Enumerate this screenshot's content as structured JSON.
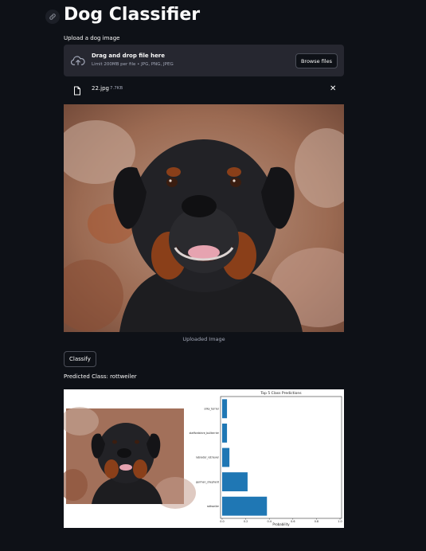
{
  "app": {
    "title": "Dog Classifier"
  },
  "uploader": {
    "label": "Upload a dog image",
    "drop_text": "Drag and drop file here",
    "limit_text": "Limit 200MB per file • JPG, PNG, JPEG",
    "browse_label": "Browse files"
  },
  "file": {
    "name": "22.jpg",
    "size": "7.7KB"
  },
  "image": {
    "caption": "Uploaded Image"
  },
  "actions": {
    "classify_label": "Classify"
  },
  "result": {
    "predicted_text": "Predicted Class: rottweiler"
  },
  "chart_data": {
    "type": "bar",
    "orientation": "horizontal",
    "title": "Top 5 Class Predictions",
    "xlabel": "Probability",
    "ylabel": "",
    "categories": [
      "silky_terrier",
      "staffordshire_bullterrier",
      "labrador_retriever",
      "german_shepherd",
      "rottweiler"
    ],
    "values": [
      0.04,
      0.04,
      0.06,
      0.21,
      0.37
    ],
    "xlim": [
      0,
      1.0
    ],
    "xticks": [
      "0.0",
      "0.2",
      "0.4",
      "0.6",
      "0.8",
      "1.0"
    ],
    "bar_color": "#1f77b4"
  },
  "colors": {
    "background": "#0e1117",
    "surface": "#262730",
    "text": "#fafafa",
    "muted": "#a3a8b8"
  }
}
